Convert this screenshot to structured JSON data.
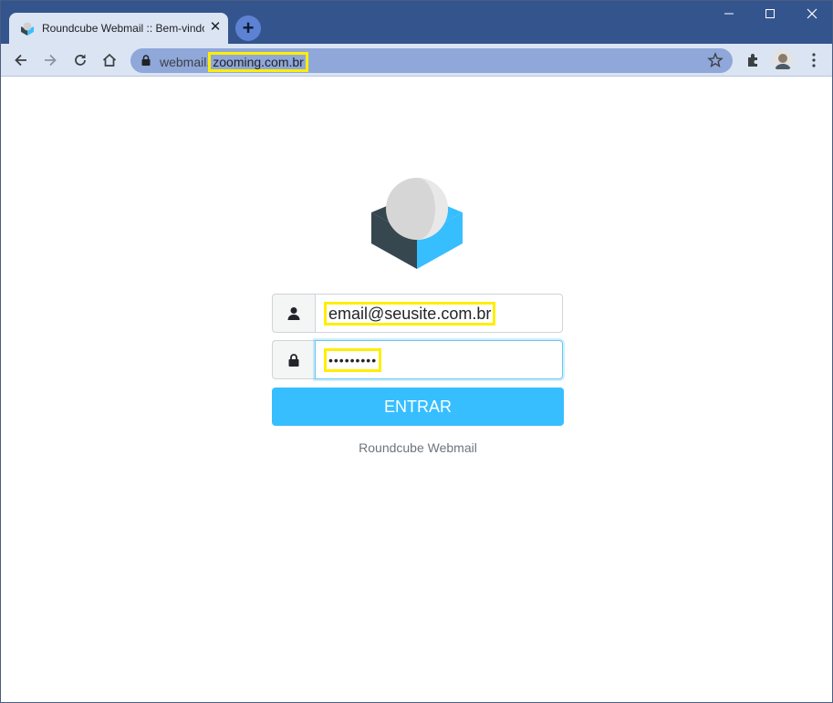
{
  "browser": {
    "tab_title": "Roundcube Webmail :: Bem-vindo ao Roundcube Webmail",
    "tab_close_glyph": "✕",
    "new_tab_glyph": "+",
    "minimize_glyph": "—",
    "maximize_glyph": "☐",
    "close_glyph": "✕",
    "url_prefix": "webmail.",
    "url_host": "zooming.com.br",
    "icons": [
      "back-arrow-icon",
      "forward-arrow-icon",
      "reload-icon",
      "home-icon",
      "lock-icon",
      "star-icon",
      "extensions-icon",
      "profile-avatar",
      "kebab-menu-icon"
    ]
  },
  "login": {
    "username_value": "email@seusite.com.br",
    "password_value": "•••••••••",
    "submit_label": "ENTRAR",
    "footer_text": "Roundcube Webmail"
  },
  "colors": {
    "accent": "#37beff",
    "tabstrip": "#34548d",
    "highlight": "#ffee00"
  }
}
